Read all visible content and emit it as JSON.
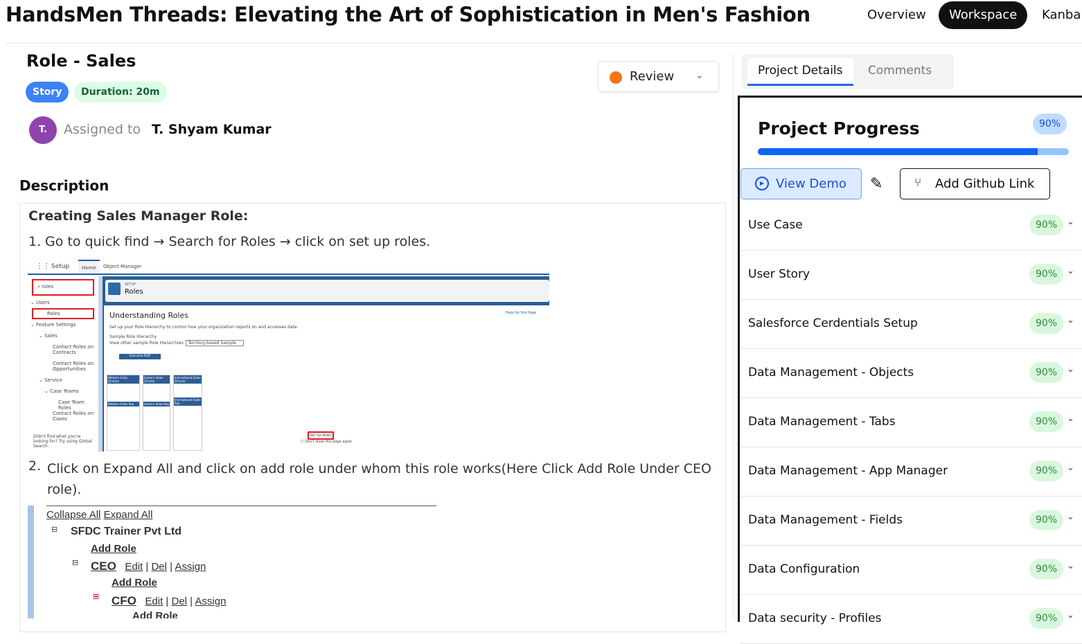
{
  "header": {
    "title": "HandsMen Threads: Elevating the Art of Sophistication in Men's Fashion",
    "nav": [
      "Overview",
      "Workspace",
      "Kanba"
    ],
    "active_nav": "Workspace"
  },
  "task": {
    "title": "Role - Sales",
    "type_badge": "Story",
    "duration_badge": "Duration: 20m",
    "avatar_initial": "T.",
    "assigned_label": "Assigned to",
    "assignee": "T. Shyam Kumar",
    "status": "Review",
    "status_color": "#f97316"
  },
  "description": {
    "heading": "Description",
    "title": "Creating Sales Manager Role:",
    "step1_num": "1.",
    "step1": "Go to quick find → Search for Roles → click on set up roles.",
    "step2_num": "2.",
    "step2": "Click on Expand All and click on add role under whom this role works(Here Click Add Role Under CEO role)."
  },
  "screenshot1": {
    "app": "Setup",
    "tabs": [
      "Home",
      "Object Manager"
    ],
    "search": "roles",
    "tree": [
      "Users",
      "Roles",
      "Feature Settings",
      "Sales",
      "Contact Roles on Contracts",
      "Contact Roles on Opportunities",
      "Service",
      "Case Teams",
      "Case Team Roles",
      "Contact Roles on Cases"
    ],
    "footer": "Didn't find what you're looking for? Try using Global Search.",
    "setup_label": "SETUP",
    "page_title": "Roles",
    "heading": "Understanding Roles",
    "help": "Help for this Page",
    "intro": "Set up your Role Hierarchy to control how your organization reports on and accesses data.",
    "sample_label": "Sample Role Hierarchy",
    "view_other": "View other sample Role Hierarchies:",
    "select": "Territory-based Sample",
    "exec": "Executive Staff",
    "directors": [
      "Western Sales Director",
      "Eastern Sales Director",
      "International Sales Director"
    ],
    "reps": [
      "Western Sales Rep",
      "Eastern Sales Rep",
      "International Sales Rep"
    ],
    "button": "Set Up Roles",
    "checkbox": "Don't show this page again"
  },
  "screenshot2": {
    "collapse": "Collapse All",
    "expand": "Expand All",
    "company": "SFDC Trainer Pvt Ltd",
    "add_role": "Add Role",
    "roles": [
      "CEO",
      "CFO"
    ],
    "actions": [
      "Edit",
      "Del",
      "Assign"
    ]
  },
  "panel": {
    "tabs": [
      "Project Details",
      "Comments"
    ],
    "progress_title": "Project Progress",
    "progress_percent": 90,
    "progress_label": "90%",
    "view_demo": "View Demo",
    "add_github": "Add Github Link",
    "items": [
      {
        "label": "Use Case",
        "pct": "90%"
      },
      {
        "label": "User Story",
        "pct": "90%"
      },
      {
        "label": "Salesforce Cerdentials Setup",
        "pct": "90%"
      },
      {
        "label": "Data Management - Objects",
        "pct": "90%"
      },
      {
        "label": "Data Management - Tabs",
        "pct": "90%"
      },
      {
        "label": "Data Management - App Manager",
        "pct": "90%"
      },
      {
        "label": "Data Management - Fields",
        "pct": "90%"
      },
      {
        "label": "Data Configuration",
        "pct": "90%"
      },
      {
        "label": "Data security - Profiles",
        "pct": "90%"
      }
    ]
  }
}
